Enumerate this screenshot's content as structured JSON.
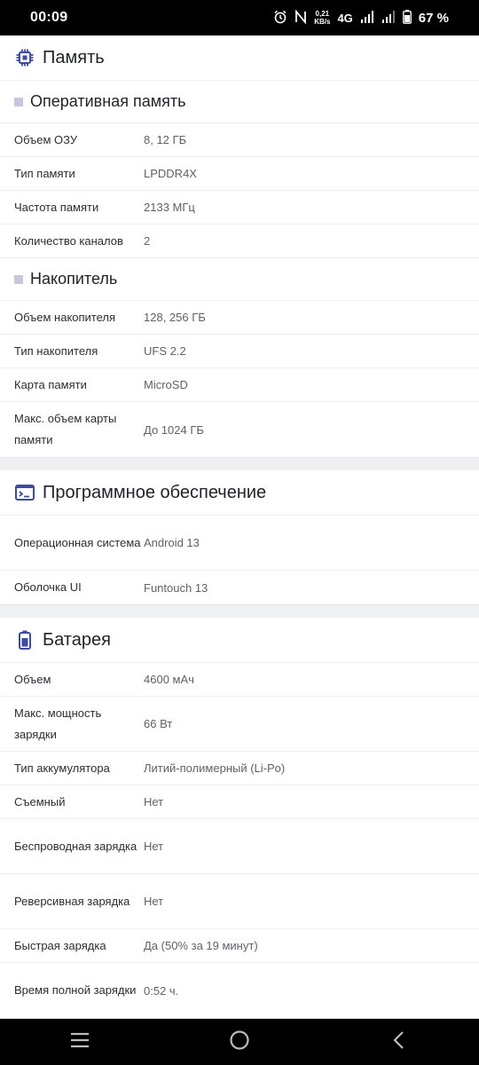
{
  "status_bar": {
    "time": "00:09",
    "net_speed_value": "0,21",
    "net_speed_unit": "KB/s",
    "network": "4G",
    "battery_percent": "67 %",
    "icons": [
      "alarm-icon",
      "nfc-icon",
      "signal-icon",
      "battery-icon"
    ]
  },
  "sections": {
    "memory": {
      "title": "Память",
      "icon": "chip-icon",
      "ram": {
        "title": "Оперативная память",
        "rows": [
          {
            "label": "Объем ОЗУ",
            "value": "8, 12 ГБ"
          },
          {
            "label": "Тип памяти",
            "value": "LPDDR4X"
          },
          {
            "label": "Частота памяти",
            "value": "2133 МГц"
          },
          {
            "label": "Количество каналов",
            "value": "2"
          }
        ]
      },
      "storage": {
        "title": "Накопитель",
        "rows": [
          {
            "label": "Объем накопителя",
            "value": "128, 256 ГБ"
          },
          {
            "label": "Тип накопителя",
            "value": "UFS 2.2"
          },
          {
            "label": "Карта памяти",
            "value": "MicroSD"
          },
          {
            "label": "Макс. объем карты памяти",
            "value": "До 1024 ГБ"
          }
        ]
      }
    },
    "software": {
      "title": "Программное обеспечение",
      "icon": "terminal-icon",
      "rows": [
        {
          "label": "Операционная система",
          "value": "Android 13"
        },
        {
          "label": "Оболочка UI",
          "value": "Funtouch 13"
        }
      ]
    },
    "battery": {
      "title": "Батарея",
      "icon": "battery-icon",
      "rows": [
        {
          "label": "Объем",
          "value": "4600 мАч"
        },
        {
          "label": "Макс. мощность зарядки",
          "value": "66 Вт"
        },
        {
          "label": "Тип аккумулятора",
          "value": "Литий-полимерный (Li-Po)"
        },
        {
          "label": "Съемный",
          "value": "Нет"
        },
        {
          "label": "Беспроводная зарядка",
          "value": "Нет"
        },
        {
          "label": "Реверсивная зарядка",
          "value": "Нет"
        },
        {
          "label": "Быстрая зарядка",
          "value": "Да (50% за 19 минут)"
        },
        {
          "label": "Время полной зарядки",
          "value": "0:52 ч."
        }
      ]
    }
  },
  "nav_bar": {
    "icons": [
      "menu-icon",
      "home-icon",
      "back-icon"
    ]
  },
  "colors": {
    "accent": "#3d4ba0",
    "subhead_marker": "#c5c8dd",
    "page_bg": "#eef0f2"
  }
}
